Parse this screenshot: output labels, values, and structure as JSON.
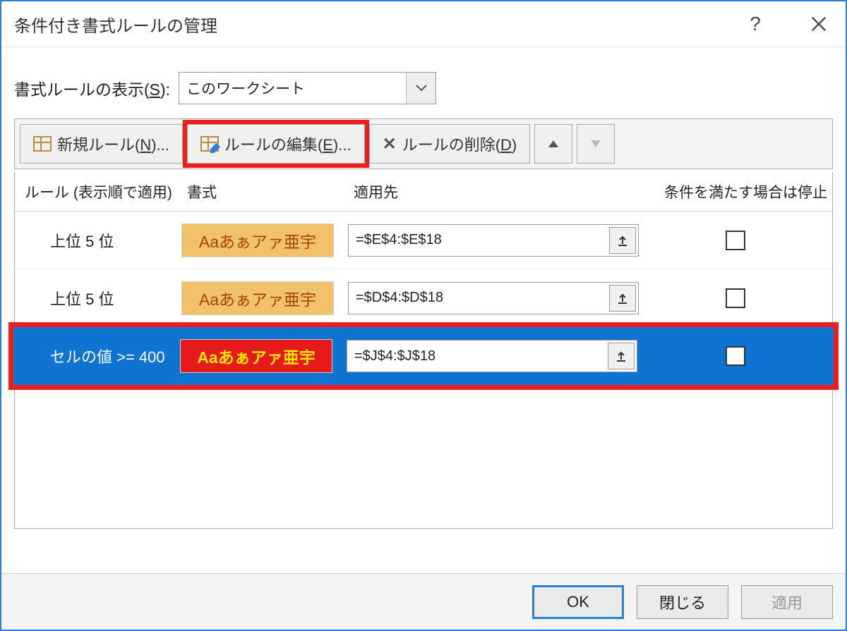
{
  "title": "条件付き書式ルールの管理",
  "help": "?",
  "filter": {
    "label_pre": "書式ルールの表示(",
    "label_key": "S",
    "label_post": "):",
    "value": "このワークシート"
  },
  "toolbar": {
    "new_pre": "新規ルール(",
    "new_key": "N",
    "new_post": ")...",
    "edit_pre": "ルールの編集(",
    "edit_key": "E",
    "edit_post": ")...",
    "delete_pre": "ルールの削除(",
    "delete_key": "D",
    "delete_post": ")",
    "delete_icon": "✕"
  },
  "columns": {
    "rule": "ルール (表示順で適用)",
    "format": "書式",
    "applies": "適用先",
    "stop": "条件を満たす場合は停止"
  },
  "rules": [
    {
      "name": "上位 5 位",
      "preview": "Aaあぁアァ亜宇",
      "preview_class": "fmt-orange",
      "applies": "=$E$4:$E$18",
      "stop": false,
      "selected": false
    },
    {
      "name": "上位 5 位",
      "preview": "Aaあぁアァ亜宇",
      "preview_class": "fmt-orange",
      "applies": "=$D$4:$D$18",
      "stop": false,
      "selected": false
    },
    {
      "name": "セルの値 >= 400",
      "preview": "Aaあぁアァ亜宇",
      "preview_class": "fmt-red",
      "applies": "=$J$4:$J$18",
      "stop": false,
      "selected": true
    }
  ],
  "buttons": {
    "ok": "OK",
    "close": "閉じる",
    "apply": "適用"
  }
}
